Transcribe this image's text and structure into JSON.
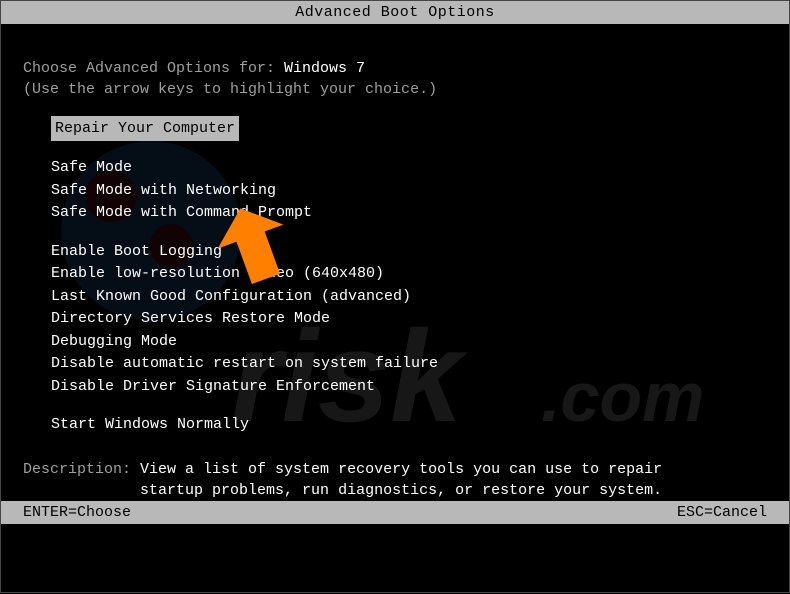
{
  "title": "Advanced Boot Options",
  "prompt_prefix": "Choose Advanced Options for: ",
  "os_name": "Windows 7",
  "hint": "(Use the arrow keys to highlight your choice.)",
  "selected": "Repair Your Computer",
  "group1": {
    "i0": "Safe Mode",
    "i1": "Safe Mode with Networking",
    "i2": "Safe Mode with Command Prompt"
  },
  "group2": {
    "i0": "Enable Boot Logging",
    "i1": "Enable low-resolution video (640x480)",
    "i2": "Last Known Good Configuration (advanced)",
    "i3": "Directory Services Restore Mode",
    "i4": "Debugging Mode",
    "i5": "Disable automatic restart on system failure",
    "i6": "Disable Driver Signature Enforcement"
  },
  "group3": {
    "i0": "Start Windows Normally"
  },
  "description_label": "Description: ",
  "description_text1": "View a list of system recovery tools you can use to repair",
  "description_text2": "startup problems, run diagnostics, or restore your system.",
  "footer_left": "ENTER=Choose",
  "footer_right": "ESC=Cancel",
  "watermark_text": "pcrisk.com",
  "arrow_color": "#ff7f00"
}
